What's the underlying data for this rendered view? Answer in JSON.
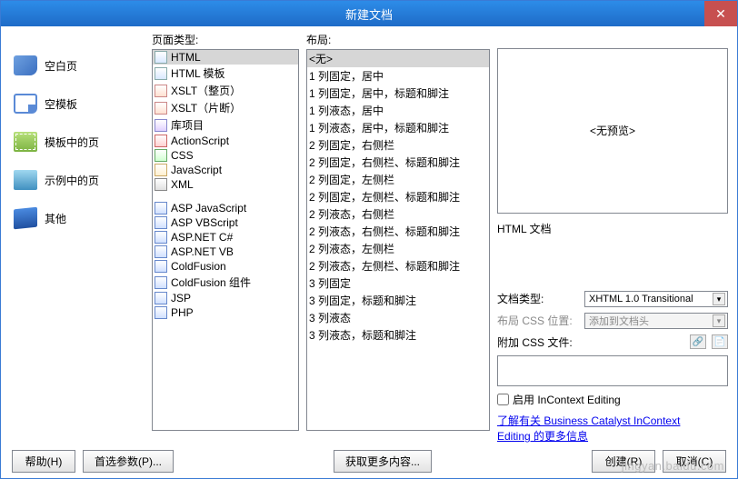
{
  "window": {
    "title": "新建文档",
    "close": "✕"
  },
  "leftnav": {
    "items": [
      {
        "label": "空白页"
      },
      {
        "label": "空模板"
      },
      {
        "label": "模板中的页"
      },
      {
        "label": "示例中的页"
      },
      {
        "label": "其他"
      }
    ]
  },
  "pagetypes": {
    "header": "页面类型:",
    "group1": [
      "HTML",
      "HTML 模板",
      "XSLT（整页）",
      "XSLT（片断）",
      "库项目",
      "ActionScript",
      "CSS",
      "JavaScript",
      "XML"
    ],
    "group2": [
      "ASP JavaScript",
      "ASP VBScript",
      "ASP.NET C#",
      "ASP.NET VB",
      "ColdFusion",
      "ColdFusion 组件",
      "JSP",
      "PHP"
    ]
  },
  "layouts": {
    "header": "布局:",
    "items": [
      "<无>",
      "1 列固定，居中",
      "1 列固定，居中，标题和脚注",
      "1 列液态，居中",
      "1 列液态，居中，标题和脚注",
      "2 列固定，右侧栏",
      "2 列固定，右侧栏、标题和脚注",
      "2 列固定，左侧栏",
      "2 列固定，左侧栏、标题和脚注",
      "2 列液态，右侧栏",
      "2 列液态，右侧栏、标题和脚注",
      "2 列液态，左侧栏",
      "2 列液态，左侧栏、标题和脚注",
      "3 列固定",
      "3 列固定，标题和脚注",
      "3 列液态",
      "3 列液态，标题和脚注"
    ]
  },
  "right": {
    "preview_text": "<无预览>",
    "description": "HTML 文档",
    "doctype_label": "文档类型:",
    "doctype_value": "XHTML 1.0 Transitional",
    "layoutcss_label": "布局 CSS 位置:",
    "layoutcss_value": "添加到文档头",
    "attachcss_label": "附加 CSS 文件:",
    "incontext_label": "启用 InContext Editing",
    "link1": "了解有关 Business Catalyst InContext",
    "link2": "Editing 的更多信息"
  },
  "footer": {
    "help": "帮助(H)",
    "prefs": "首选参数(P)...",
    "more": "获取更多内容...",
    "create": "创建(R)",
    "cancel": "取消(C)"
  },
  "watermark": "jingyan.baidu.com"
}
